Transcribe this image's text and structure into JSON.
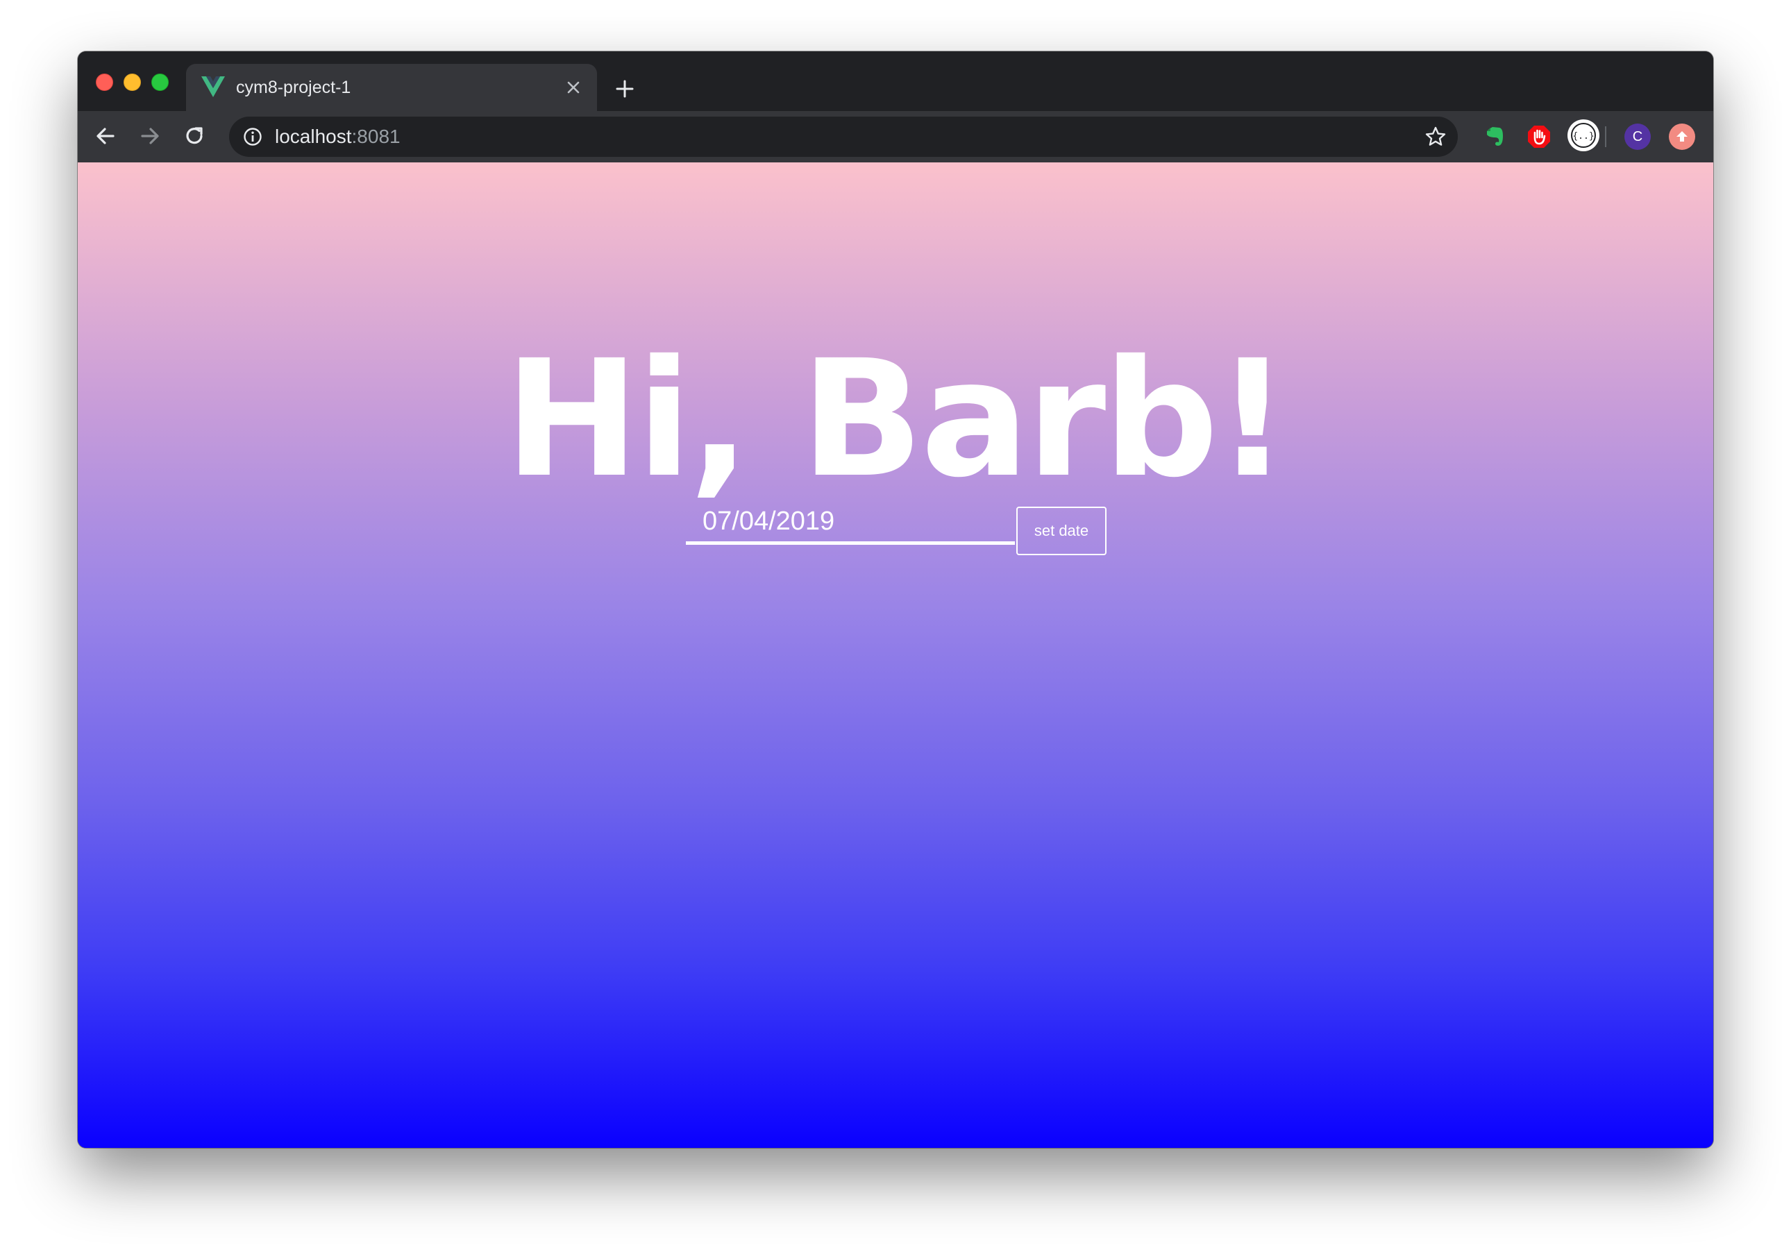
{
  "browser": {
    "tab": {
      "title": "cym8-project-1",
      "favicon": "vue-logo-icon"
    },
    "new_tab_symbol": "+",
    "address_bar": {
      "host": "localhost",
      "port": ":8081"
    },
    "extensions": [
      {
        "name": "evernote-icon",
        "color": "#2dbe60"
      },
      {
        "name": "adblock-icon",
        "color": "#f40d12"
      },
      {
        "name": "json-viewer-icon",
        "color": "#ffffff"
      },
      {
        "name": "profile-avatar-icon",
        "color": "#5433a3",
        "letter": "C"
      },
      {
        "name": "update-icon",
        "color": "#f28b82"
      }
    ]
  },
  "page": {
    "greeting": "Hi, Barb!",
    "date_input": {
      "value": "07/04/2019"
    },
    "set_date_label": "set date",
    "background_gradient": [
      "#fbc1cc",
      "#0a00ff"
    ]
  }
}
